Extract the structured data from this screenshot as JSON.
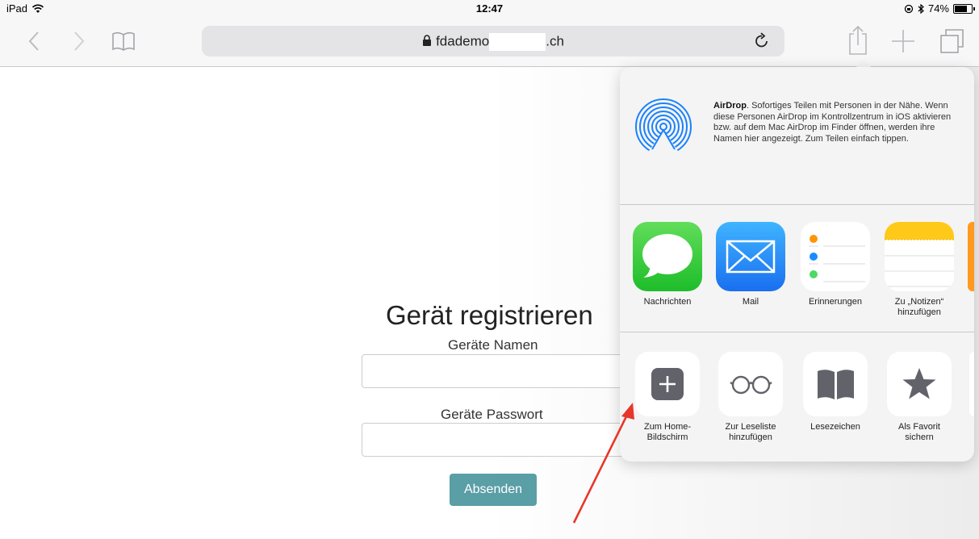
{
  "status_bar": {
    "device": "iPad",
    "time": "12:47",
    "battery": "74%",
    "battery_level": 0.74
  },
  "browser": {
    "url_prefix": "fdademo",
    "url_suffix": ".ch"
  },
  "form": {
    "title": "Gerät registrieren",
    "name_label": "Geräte Namen",
    "password_label": "Geräte Passwort",
    "submit_label": "Absenden"
  },
  "share_sheet": {
    "airdrop_title": "AirDrop",
    "airdrop_text": ". Sofortiges Teilen mit Personen in der Nähe. Wenn diese Personen AirDrop im Kontrollzentrum in iOS aktivieren bzw. auf dem Mac AirDrop im Finder öffnen, werden ihre Namen hier angezeigt. Zum Teilen einfach tippen.",
    "apps": [
      {
        "label": "Nachrichten",
        "icon": "messages-icon"
      },
      {
        "label": "Mail",
        "icon": "mail-icon"
      },
      {
        "label": "Erinnerungen",
        "icon": "reminders-icon"
      },
      {
        "label": "Zu „Notizen“ hinzufügen",
        "icon": "notes-icon"
      }
    ],
    "actions": [
      {
        "label": "Zum Home-Bildschirm",
        "icon": "add-icon"
      },
      {
        "label": "Zur Leseliste hinzufügen",
        "icon": "glasses-icon"
      },
      {
        "label": "Lesezeichen",
        "icon": "book-icon"
      },
      {
        "label": "Als Favorit sichern",
        "icon": "star-icon"
      }
    ]
  },
  "colors": {
    "accent": "#5a9ea6",
    "ios_blue": "#1a82fb",
    "annotation": "#e8362a"
  }
}
